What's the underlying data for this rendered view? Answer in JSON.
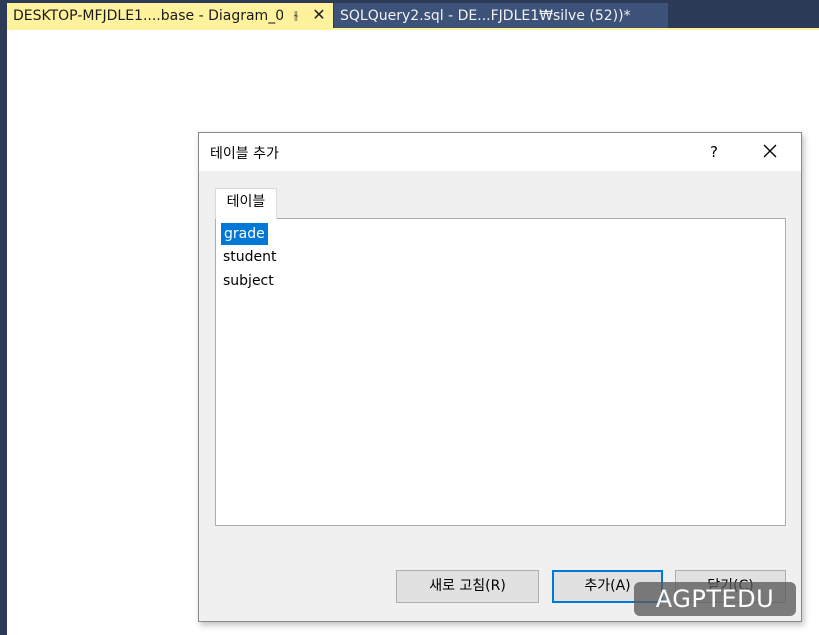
{
  "tabs": [
    {
      "label": "DESKTOP-MFJDLE1....base - Diagram_0",
      "active": true
    },
    {
      "label": "SQLQuery2.sql - DE...FJDLE1₩silve (52))*",
      "active": false
    }
  ],
  "dialog": {
    "title": "테이블 추가",
    "help_label": "?",
    "tab_label": "테이블",
    "tables": [
      "grade",
      "student",
      "subject"
    ],
    "selected_table": "grade",
    "buttons": {
      "refresh": "새로 고침(R)",
      "add": "추가(A)",
      "close": "닫기(C)"
    }
  },
  "watermark": "AGPTEDU",
  "colors": {
    "active_tab": "#fff29d",
    "inactive_tab": "#3d5278",
    "selection": "#0078d7",
    "ide_background": "#2b3a56"
  },
  "icons": {
    "pin": "pin-icon",
    "tab_close": "close-icon",
    "dialog_close": "close-icon"
  }
}
